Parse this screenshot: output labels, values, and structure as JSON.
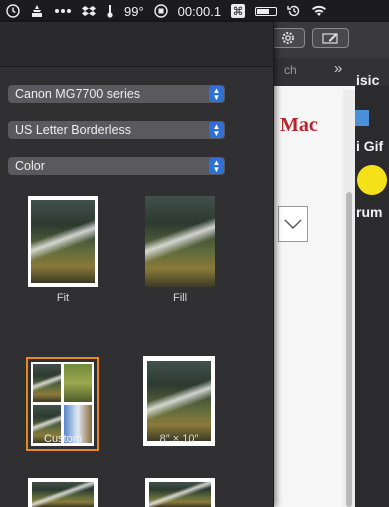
{
  "menubar": {
    "temperature": "99°",
    "timer": "00:00.1"
  },
  "print_panel": {
    "printer": "Canon MG7700 series",
    "paper_size": "US Letter Borderless",
    "color_mode": "Color",
    "layouts": [
      {
        "label": "Fit"
      },
      {
        "label": "Fill"
      },
      {
        "label": "Custom",
        "selected": true
      },
      {
        "label": "8″ × 10″"
      }
    ]
  },
  "background_app": {
    "search_fragment": "ch",
    "chevron": "»",
    "headline_fragment": "Mac",
    "sidebar_texts": [
      "isic",
      "i Gif",
      "rum"
    ]
  },
  "colors": {
    "accent_blue": "#2f6fd6",
    "selection_orange": "#e8891f",
    "headline_red": "#b3262d"
  }
}
